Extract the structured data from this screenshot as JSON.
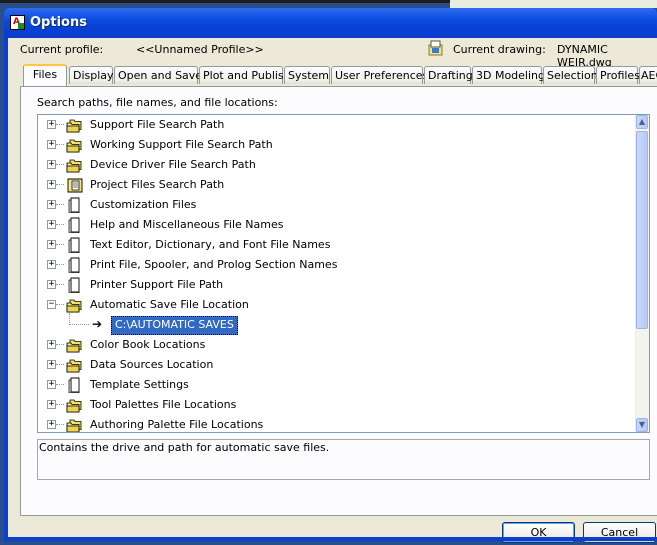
{
  "window": {
    "title": "Options"
  },
  "profile": {
    "label": "Current profile:",
    "value": "<<Unnamed Profile>>",
    "drawing_label": "Current drawing:",
    "drawing_value": "DYNAMIC WEIR.dwg"
  },
  "tabs": [
    {
      "label": "Files"
    },
    {
      "label": "Display"
    },
    {
      "label": "Open and Save"
    },
    {
      "label": "Plot and Publish"
    },
    {
      "label": "System"
    },
    {
      "label": "User Preferences"
    },
    {
      "label": "Drafting"
    },
    {
      "label": "3D Modeling"
    },
    {
      "label": "Selection"
    },
    {
      "label": "Profiles"
    },
    {
      "label": "AEC"
    }
  ],
  "active_tab": "Files",
  "panel": {
    "section_label": "Search paths, file names, and file locations:"
  },
  "tree": {
    "items": [
      {
        "label": "Support File Search Path",
        "icon": "folders-icon",
        "expander": "+"
      },
      {
        "label": "Working Support File Search Path",
        "icon": "folders-icon",
        "expander": "+"
      },
      {
        "label": "Device Driver File Search Path",
        "icon": "folders-icon",
        "expander": "+"
      },
      {
        "label": "Project Files Search Path",
        "icon": "project-icon",
        "expander": "+"
      },
      {
        "label": "Customization Files",
        "icon": "document-icon",
        "expander": "+"
      },
      {
        "label": "Help and Miscellaneous File Names",
        "icon": "document-icon",
        "expander": "+"
      },
      {
        "label": "Text Editor, Dictionary, and Font File Names",
        "icon": "document-icon",
        "expander": "+"
      },
      {
        "label": "Print File, Spooler, and Prolog Section Names",
        "icon": "document-icon",
        "expander": "+"
      },
      {
        "label": "Printer Support File Path",
        "icon": "document-icon",
        "expander": "+"
      },
      {
        "label": "Automatic Save File Location",
        "icon": "folders-icon",
        "expander": "−"
      },
      {
        "label": "Color Book Locations",
        "icon": "folders-icon",
        "expander": "+"
      },
      {
        "label": "Data Sources Location",
        "icon": "folders-icon",
        "expander": "+"
      },
      {
        "label": "Template Settings",
        "icon": "document-icon",
        "expander": "+"
      },
      {
        "label": "Tool Palettes File Locations",
        "icon": "folders-icon",
        "expander": "+"
      },
      {
        "label": "Authoring Palette File Locations",
        "icon": "folders-icon",
        "expander": "+"
      }
    ],
    "expanded_child": {
      "value": "C:\\AUTOMATIC SAVES",
      "icon": "arrow-right-icon"
    }
  },
  "description": "Contains the drive and path for automatic save files.",
  "buttons": {
    "ok": "OK",
    "cancel": "Cancel"
  },
  "colors": {
    "title_bar": "#0a4be0",
    "selection": "#316ac5",
    "active_tab_accent": "#ffc83c"
  }
}
